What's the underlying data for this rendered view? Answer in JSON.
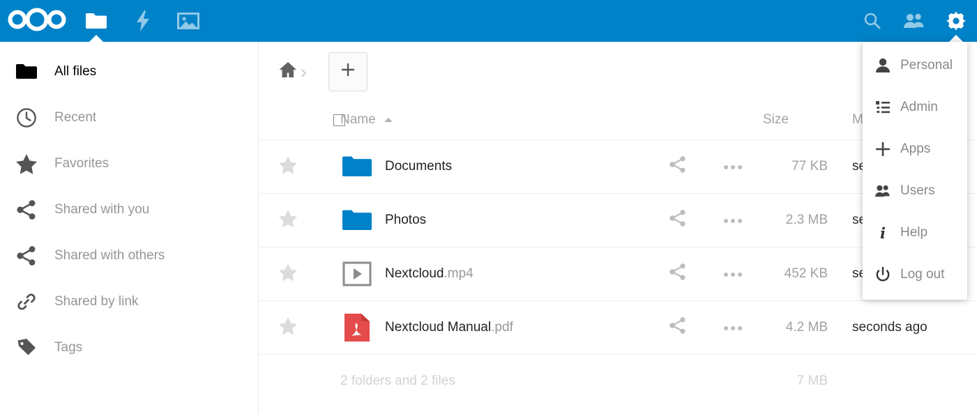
{
  "header": {
    "brand": "Nextcloud",
    "logo_icon": "nextcloud-logo",
    "apps": [
      {
        "name": "files",
        "icon": "folder-icon",
        "active": true
      },
      {
        "name": "activity",
        "icon": "lightning-icon",
        "active": false
      },
      {
        "name": "gallery",
        "icon": "image-icon",
        "active": false
      }
    ],
    "right_icons": [
      {
        "name": "search",
        "icon": "search-icon",
        "active": false
      },
      {
        "name": "contacts",
        "icon": "contacts-icon",
        "active": false
      },
      {
        "name": "settings",
        "icon": "gear-icon",
        "active": true
      }
    ],
    "background_color": "#0082c9"
  },
  "settings_menu": {
    "open": true,
    "items": [
      {
        "label": "Personal",
        "icon": "person-icon"
      },
      {
        "label": "Admin",
        "icon": "list-icon"
      },
      {
        "label": "Apps",
        "icon": "plus-icon"
      },
      {
        "label": "Users",
        "icon": "users-icon"
      },
      {
        "label": "Help",
        "icon": "info-icon"
      },
      {
        "label": "Log out",
        "icon": "power-icon"
      }
    ]
  },
  "sidebar": {
    "items": [
      {
        "label": "All files",
        "icon": "folder-icon",
        "active": true
      },
      {
        "label": "Recent",
        "icon": "clock-icon",
        "active": false
      },
      {
        "label": "Favorites",
        "icon": "star-icon",
        "active": false
      },
      {
        "label": "Shared with you",
        "icon": "share-icon",
        "active": false
      },
      {
        "label": "Shared with others",
        "icon": "share-icon",
        "active": false
      },
      {
        "label": "Shared by link",
        "icon": "link-icon",
        "active": false
      },
      {
        "label": "Tags",
        "icon": "tag-icon",
        "active": false
      }
    ]
  },
  "content": {
    "breadcrumb": {
      "home_icon": "home-icon",
      "separator": "›"
    },
    "new_button": {
      "label": "+",
      "icon": "plus-icon"
    },
    "table": {
      "headers": {
        "select_all": "",
        "name": "Name",
        "size": "Size",
        "modified": "Modified",
        "sort_direction": "ascending"
      },
      "rows": [
        {
          "favorite": false,
          "icon": "folder-icon",
          "name": "Documents",
          "extension": "",
          "size": "77 KB",
          "modified": "seconds ago"
        },
        {
          "favorite": false,
          "icon": "folder-icon",
          "name": "Photos",
          "extension": "",
          "size": "2.3 MB",
          "modified": "seconds ago"
        },
        {
          "favorite": false,
          "icon": "video-icon",
          "name": "Nextcloud",
          "extension": ".mp4",
          "size": "452 KB",
          "modified": "seconds ago"
        },
        {
          "favorite": false,
          "icon": "pdf-icon",
          "name": "Nextcloud Manual",
          "extension": ".pdf",
          "size": "4.2 MB",
          "modified": "seconds ago"
        }
      ],
      "summary": {
        "text": "2 folders and 2 files",
        "total_size": "7 MB"
      }
    }
  },
  "colors": {
    "brand_blue": "#0082c9",
    "folder_blue": "#0082c9",
    "pdf_red": "#e54b4b",
    "text_muted": "#969696"
  }
}
